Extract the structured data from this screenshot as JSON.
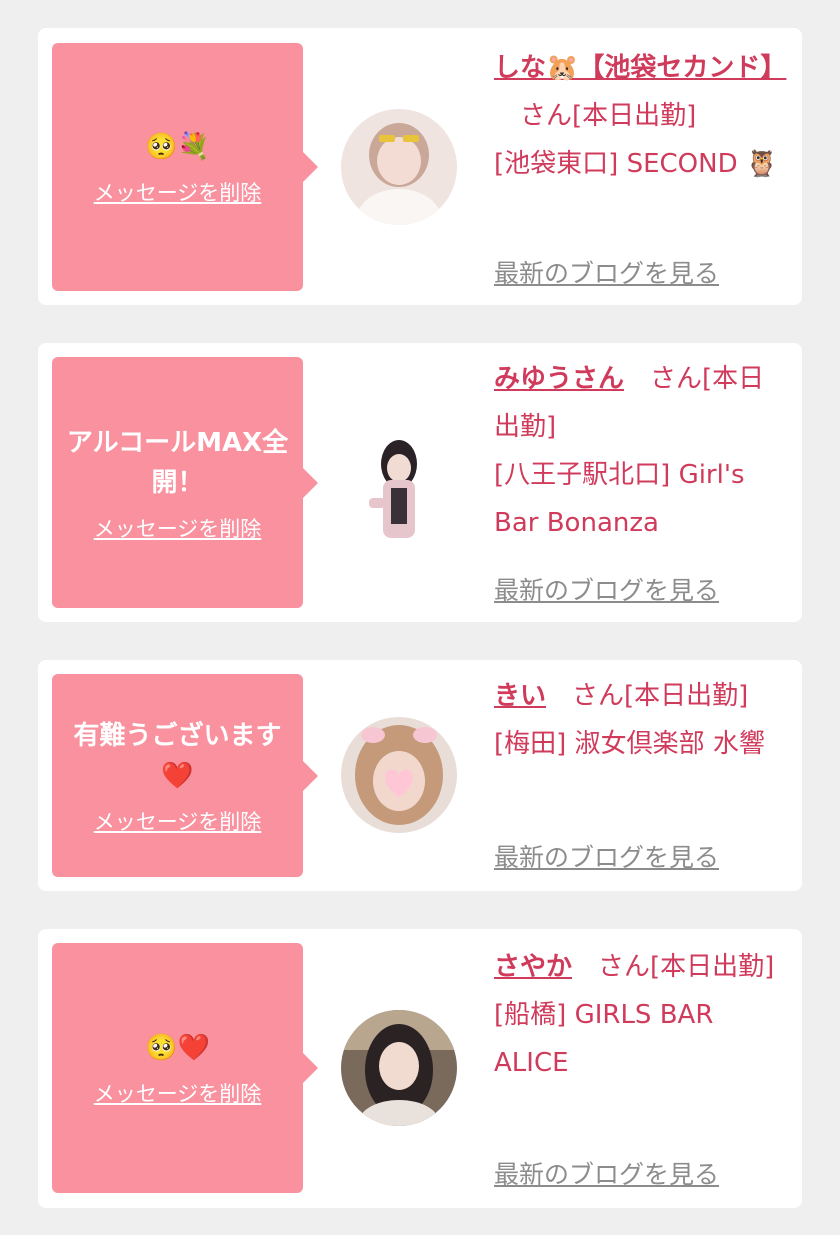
{
  "cards": [
    {
      "message": "🥺💐",
      "delete_label": "メッセージを削除",
      "name": "しな🐹【池袋セカンド】",
      "suffix": "さん[本日出勤]",
      "area": "[池袋東口]",
      "shop": "SECOND 🦉",
      "blog_label": "最新のブログを見る"
    },
    {
      "message": "アルコールMAX全開！",
      "delete_label": "メッセージを削除",
      "name": "みゆうさん",
      "suffix": "さん[本日出勤]",
      "area": "[八王子駅北口]",
      "shop": "Girl's Bar Bonanza",
      "blog_label": "最新のブログを見る"
    },
    {
      "message": "有難うございます❤️",
      "delete_label": "メッセージを削除",
      "name": "きい",
      "suffix": "さん[本日出勤]",
      "area": "[梅田]",
      "shop": "淑女倶楽部 水響",
      "blog_label": "最新のブログを見る"
    },
    {
      "message": "🥺❤️",
      "delete_label": "メッセージを削除",
      "name": "さやか",
      "suffix": "さん[本日出勤]",
      "area": "[船橋]",
      "shop": "GIRLS BAR ALICE",
      "blog_label": "最新のブログを見る"
    }
  ],
  "colors": {
    "bubble": "#f9919f",
    "name": "#d03a5b",
    "link_gray": "#8c8c8c",
    "card_bg": "#ffffff",
    "page_bg": "#efefef"
  }
}
